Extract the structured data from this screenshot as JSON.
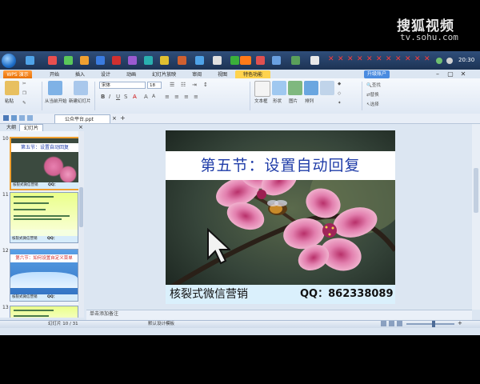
{
  "watermark": {
    "brand": "搜狐视频",
    "url": "tv.sohu.com"
  },
  "titlebar": {
    "app_button": "WPS 演示",
    "upgrade": "升级账户"
  },
  "taskbar": {
    "clock": "20:30"
  },
  "menu": {
    "tabs": [
      "开始",
      "插入",
      "设计",
      "动画",
      "幻灯片放映",
      "审阅",
      "视图",
      "特色功能"
    ],
    "active_index": 7
  },
  "ribbon": {
    "paste": "粘贴",
    "new_slide": "新建幻灯片",
    "from_current": "从当前开始",
    "font_name": "宋体",
    "font_size": "18",
    "textbox": "文本框",
    "shapes": "形状",
    "picture": "图片",
    "arrange": "排列",
    "find": "查找",
    "replace": "替换",
    "select": "选择"
  },
  "document": {
    "tab_name": "公众平台.ppt"
  },
  "panel": {
    "tab_outline": "大纲",
    "tab_slides": "幻灯片",
    "thumbnails": [
      {
        "num": "10",
        "title": "第五节：设置自动回复",
        "footer": "核裂式微信营销",
        "qq": "QQ：862338089"
      },
      {
        "num": "11",
        "footer": "核裂式微信营销",
        "qq": "QQ：862338089"
      },
      {
        "num": "12",
        "title": "第六节：如何设置自定义菜单",
        "footer": "核裂式微信营销",
        "qq": "QQ：862338089"
      },
      {
        "num": "13"
      }
    ]
  },
  "slide": {
    "title": "第五节：设置自动回复",
    "brand": "核裂式微信营销",
    "qq": "QQ：862338089"
  },
  "notes": {
    "placeholder": "单击添加备注"
  },
  "status": {
    "slide_counter": "幻灯片 10 / 31",
    "theme": "默认设计模板"
  }
}
